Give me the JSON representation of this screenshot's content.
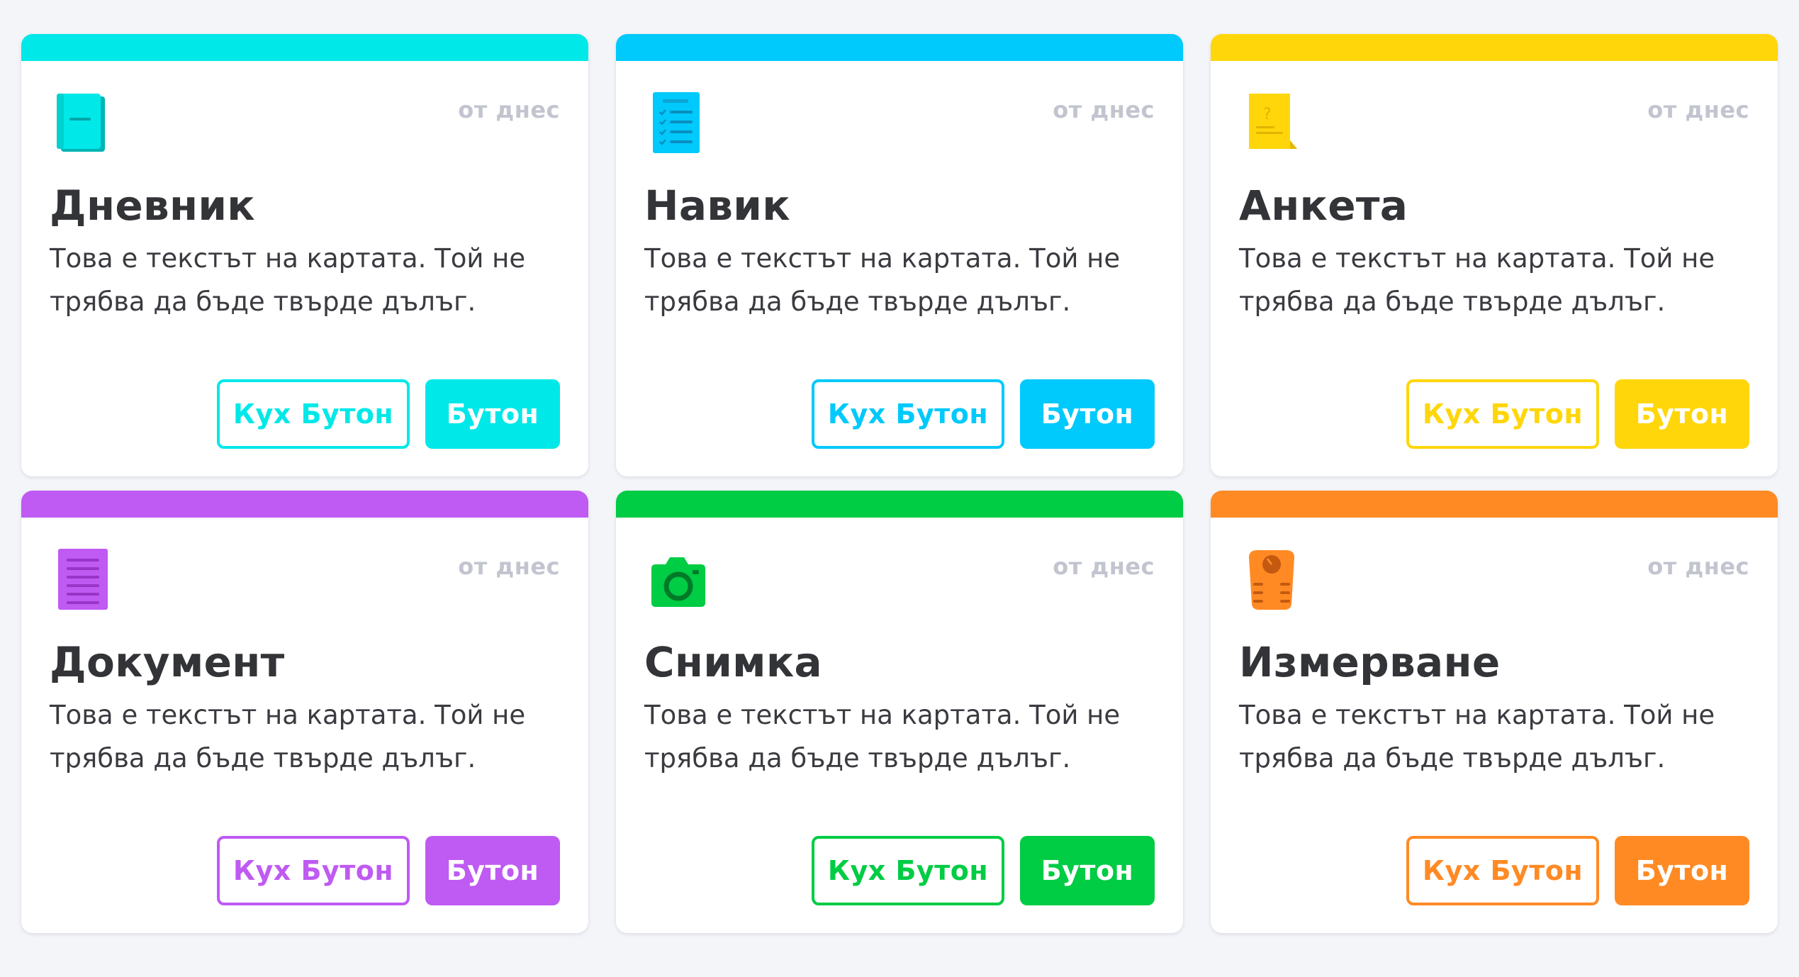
{
  "cards": [
    {
      "color": "#00e8e8",
      "icon": "diary-icon",
      "date": "от днес",
      "title": "Дневник",
      "text": "Това е текстът на картата. Той не трябва да бъде твърде дълъг.",
      "secondary_button": "Кух Бутон",
      "primary_button": "Бутон"
    },
    {
      "color": "#00c9fb",
      "icon": "checklist-icon",
      "date": "от днес",
      "title": "Навик",
      "text": "Това е текстът на картата. Той не трябва да бъде твърде дълъг.",
      "secondary_button": "Кух Бутон",
      "primary_button": "Бутон"
    },
    {
      "color": "#ffd60a",
      "icon": "sticky-note-icon",
      "date": "от днес",
      "title": "Анкета",
      "text": "Това е текстът на картата. Той не трябва да бъде твърде дълъг.",
      "secondary_button": "Кух Бутон",
      "primary_button": "Бутон"
    },
    {
      "color": "#bf5af2",
      "icon": "document-icon",
      "date": "от днес",
      "title": "Документ",
      "text": "Това е текстът на картата. Той не трябва да бъде твърде дълъг.",
      "secondary_button": "Кух Бутон",
      "primary_button": "Бутон"
    },
    {
      "color": "#00cc44",
      "icon": "camera-icon",
      "date": "от днес",
      "title": "Снимка",
      "text": "Това е текстът на картата. Той не трябва да бъде твърде дълъг.",
      "secondary_button": "Кух Бутон",
      "primary_button": "Бутон"
    },
    {
      "color": "#ff8a24",
      "icon": "scale-icon",
      "date": "от днес",
      "title": "Измерване",
      "text": "Това е текстът на картата. Той не трябва да бъде твърде дълъг.",
      "secondary_button": "Кух Бутон",
      "primary_button": "Бутон"
    }
  ]
}
